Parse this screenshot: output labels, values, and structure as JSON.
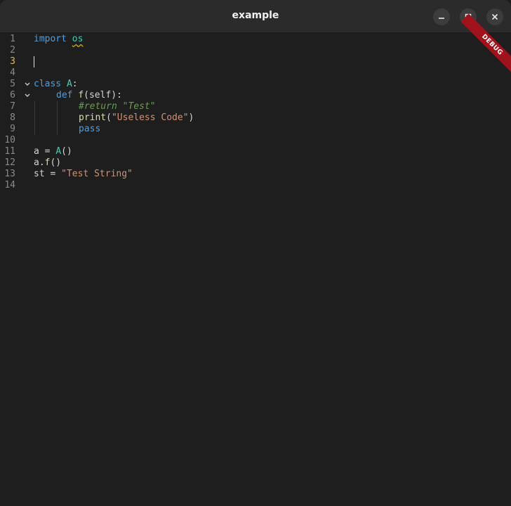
{
  "window": {
    "title": "example"
  },
  "badge": {
    "debug": "DEBUG"
  },
  "icons": {
    "minimize": "minimize-icon",
    "maximize": "maximize-icon",
    "close": "close-icon",
    "fold": "chevron-down-icon"
  },
  "colors": {
    "keyword": "#569cd6",
    "function": "#dcdcaa",
    "class": "#4ec9b0",
    "string": "#ce9178",
    "comment": "#6a9955",
    "active_line_number": "#e5b94a",
    "ribbon": "#a0131c"
  },
  "editor": {
    "active_line": 3,
    "line_numbers": [
      "1",
      "2",
      "3",
      "4",
      "5",
      "6",
      "7",
      "8",
      "9",
      "10",
      "11",
      "12",
      "13",
      "14"
    ],
    "tokens": {
      "l1_import": "import",
      "l1_os": "os",
      "l5_class": "class",
      "l5_A": "A",
      "l5_colon": ":",
      "l6_def": "def",
      "l6_f": "f",
      "l6_rest": "(self):",
      "l7_comment": "#return \"Test\"",
      "l8_print": "print",
      "l8_open": "(",
      "l8_str": "\"Useless Code\"",
      "l8_close": ")",
      "l9_pass": "pass",
      "l11_a": "a = ",
      "l11_A": "A",
      "l11_paren": "()",
      "l12_a": "a.",
      "l12_f": "f",
      "l12_paren": "()",
      "l13_st": "st = ",
      "l13_str": "\"Test String\""
    }
  }
}
